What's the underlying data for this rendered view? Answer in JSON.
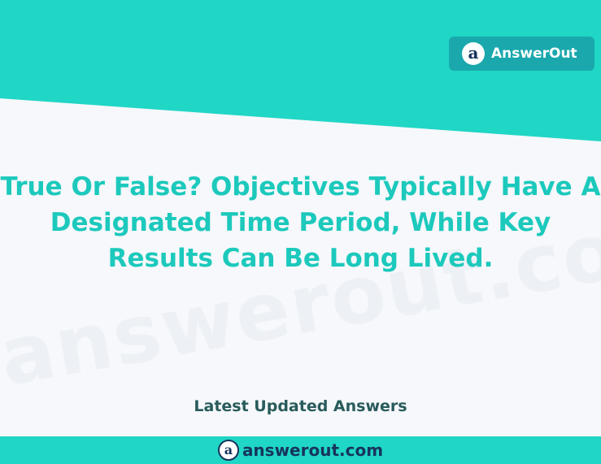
{
  "brand": {
    "badge_logo_icon": "answerout-a-logo-icon",
    "badge_logo_text": "a",
    "badge_name": "AnswerOut"
  },
  "question": {
    "lines": [
      "True Or False? Objectives Typically Have A",
      "Designated Time Period, While Key",
      "Results Can Be Long Lived."
    ]
  },
  "section_label": "Latest Updated Answers",
  "footer": {
    "logo_icon": "answerout-a-logo-icon",
    "logo_text": "a",
    "site_text": "answerout.com"
  },
  "watermark_text": "answerout.com",
  "colors": {
    "teal_band": "#20d6c5",
    "badge_bg": "#1aa8ad",
    "question_text": "#1cc9bc",
    "section_text": "#295b5b",
    "footer_text": "#17345d",
    "background": "#f6f8fb"
  }
}
